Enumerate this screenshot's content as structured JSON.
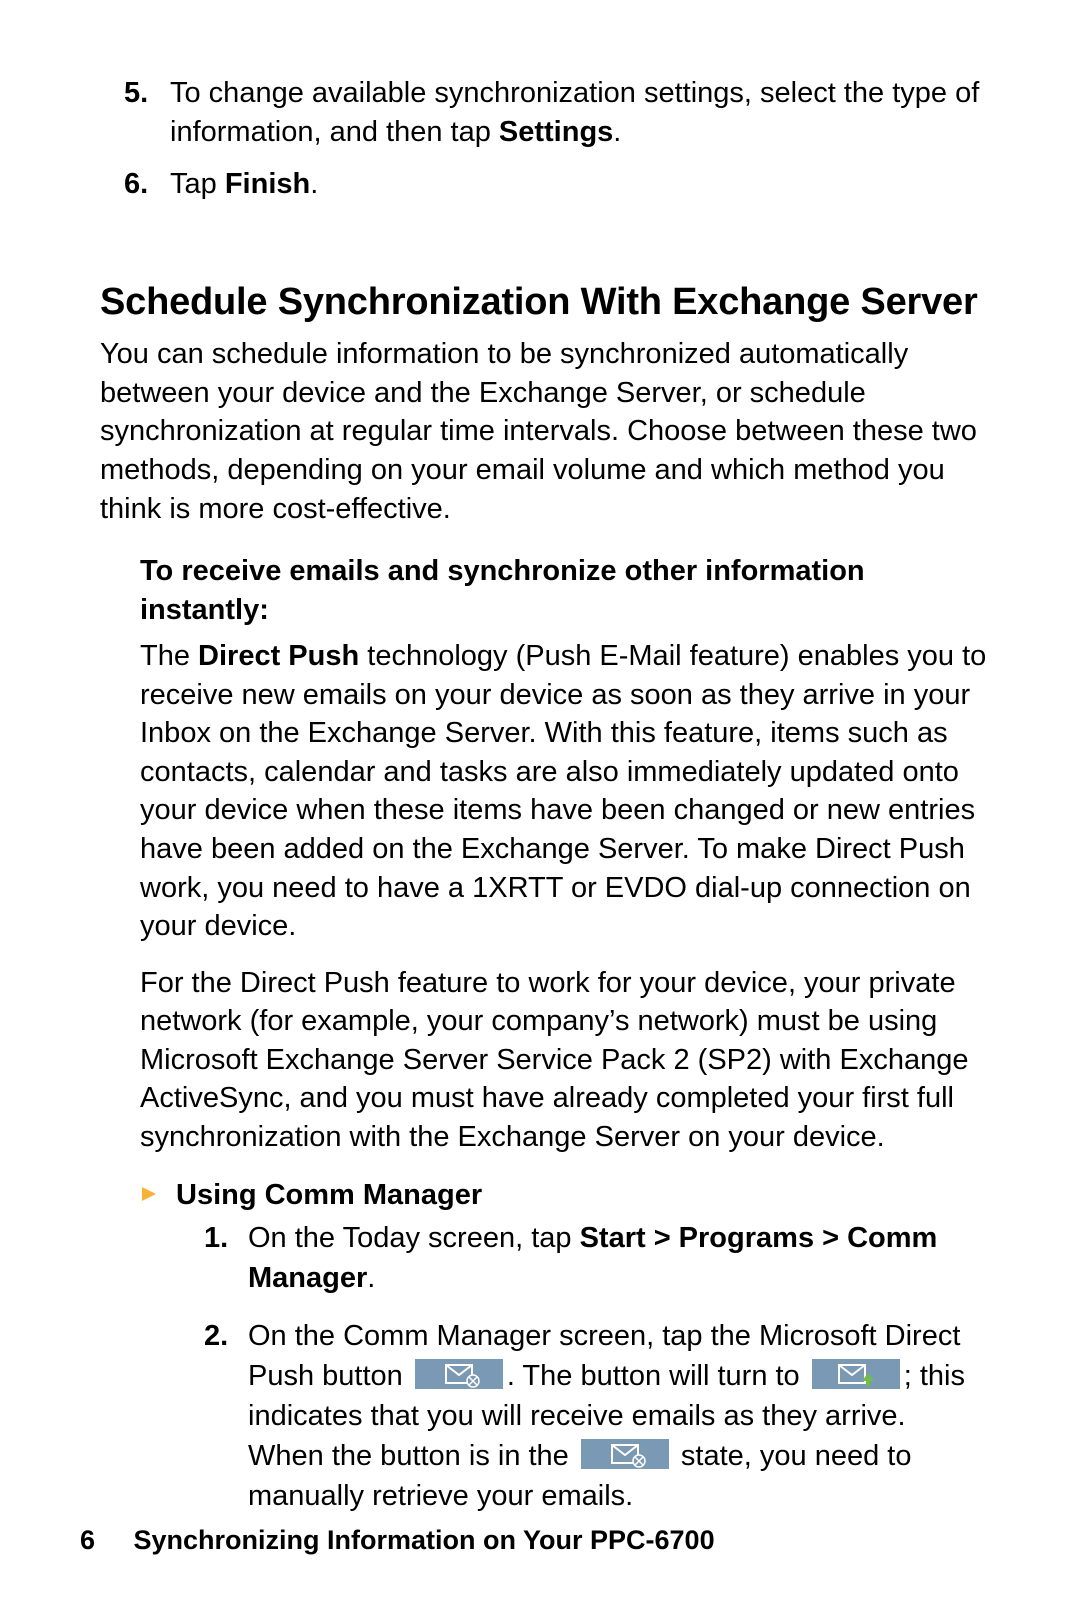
{
  "colors": {
    "icon_bg": "#7a99b5",
    "icon_stroke": "#ffffff",
    "icon_accent_green": "#6fbf44",
    "triangle": "#f9b233"
  },
  "steps_top": [
    {
      "num": "5.",
      "pre": "To change available synchronization settings, select the type of information, and then tap ",
      "bold1": "Settings",
      "post": "."
    },
    {
      "num": "6.",
      "pre": "Tap ",
      "bold1": "Finish",
      "post": "."
    }
  ],
  "heading": "Schedule Synchronization With Exchange Server",
  "intro": "You can schedule information to be synchronized automatically between your device and the Exchange Server, or schedule synchronization at regular time intervals. Choose between these two methods, depending on your email volume and which method you think is more cost-effective.",
  "subheading1": "To receive emails and synchronize other information instantly:",
  "para1_pre": "The ",
  "para1_bold": "Direct Push",
  "para1_post": " technology (Push E-Mail feature) enables you to receive new emails on your device as soon as they arrive in your Inbox on the Exchange Server. With this feature, items such as contacts, calendar and tasks are also immediately updated onto your device when these items have been changed or new entries have been added on the Exchange Server. To make Direct Push work, you need to have a 1XRTT or EVDO dial-up connection on your device.",
  "para2": "For the Direct Push feature to work for your device, your private network (for example, your company’s network) must be using Microsoft Exchange Server Service Pack 2 (SP2) with Exchange ActiveSync, and you must have already completed your first full synchronization with the Exchange Server on your device.",
  "bullet_label": "Using Comm Manager",
  "inner_steps": {
    "s1": {
      "num": "1.",
      "a": "On the Today screen, tap ",
      "b": "Start > Programs > Comm Manager",
      "c": "."
    },
    "s2": {
      "num": "2.",
      "t1": "On the Comm Manager screen, tap the Microsoft Direct Push button ",
      "t2": ". The button will turn to ",
      "t3": "; this indicates that you will receive emails as they arrive. When the button is in the ",
      "t4": " state, you need to manually retrieve your emails."
    }
  },
  "footer": {
    "page": "6",
    "title": "Synchronizing Information on Your PPC-6700"
  }
}
